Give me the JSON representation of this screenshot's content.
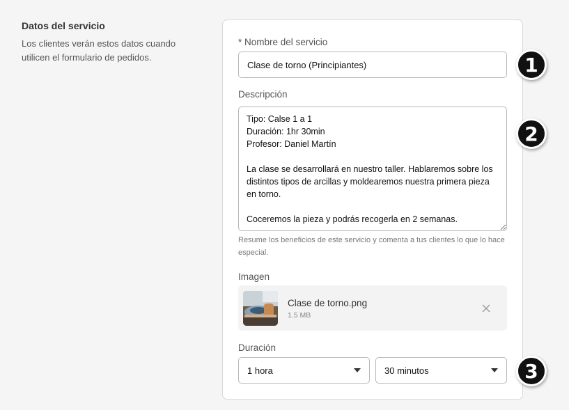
{
  "section": {
    "title": "Datos del servicio",
    "description": "Los clientes verán estos datos cuando utilicen el formulario de pedidos."
  },
  "form": {
    "name_label": "* Nombre del servicio",
    "name_value": "Clase de torno (Principiantes)",
    "description_label": "Descripción",
    "description_value": "Tipo: Calse 1 a 1\nDuración: 1hr 30min\nProfesor: Daniel Martín\n\nLa clase se desarrollará en nuestro taller. Hablaremos sobre los distintos tipos de arcillas y moldearemos nuestra primera pieza en torno.\n\nCoceremos la pieza y podrás recogerla en 2 semanas.",
    "description_helper": "Resume los beneficios de este servicio y comenta a tus clientes lo que lo hace especial.",
    "image_label": "Imagen",
    "image_file_name": "Clase de torno.png",
    "image_file_size": "1.5 MB",
    "duration_label": "Duración",
    "duration_hours": "1 hora",
    "duration_minutes": "30 minutos"
  },
  "badges": [
    "1",
    "2",
    "3"
  ],
  "icons": {
    "remove_file": "close-icon",
    "dropdown": "chevron-down-icon"
  },
  "colors": {
    "background": "#f5f5f5",
    "card": "#ffffff",
    "badge": "#111111"
  }
}
